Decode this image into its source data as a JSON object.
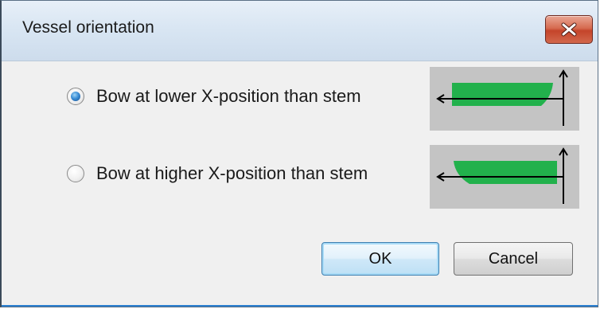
{
  "dialog": {
    "title": "Vessel orientation",
    "close_icon": "close-x-icon"
  },
  "options": [
    {
      "label": "Bow at lower X-position than stem",
      "selected": true,
      "preview_icon": "bow-left-vessel-icon"
    },
    {
      "label": "Bow at higher X-position than stem",
      "selected": false,
      "preview_icon": "bow-right-vessel-icon"
    }
  ],
  "buttons": {
    "ok_label": "OK",
    "cancel_label": "Cancel"
  },
  "colors": {
    "vessel_green": "#22b14c",
    "preview_background": "#c4c4c4",
    "close_button_red": "#c9492d",
    "selected_radio_blue": "#3b8ed6"
  }
}
